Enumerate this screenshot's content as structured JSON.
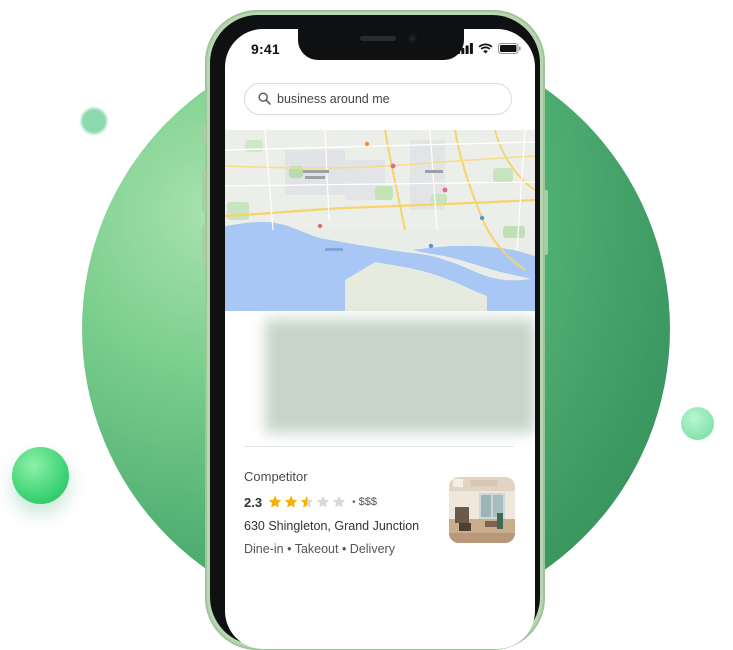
{
  "status_bar": {
    "time": "9:41"
  },
  "search": {
    "value": "business around me"
  },
  "listing": {
    "name": "Competitor",
    "rating": "2.3",
    "stars_value": 2.5,
    "stars_max": 5,
    "separator": "•",
    "price": "$$$",
    "address": "630 Shingleton, Grand Junction",
    "services": "Dine-in • Takeout • Delivery"
  },
  "colors": {
    "accent_green": "#3d9a63",
    "star": "#f4b400",
    "star_empty": "#d8d8d8",
    "water": "#a7c7f2"
  },
  "icons": [
    "search-icon",
    "signal-icon",
    "wifi-icon",
    "battery-icon",
    "star-icon"
  ]
}
